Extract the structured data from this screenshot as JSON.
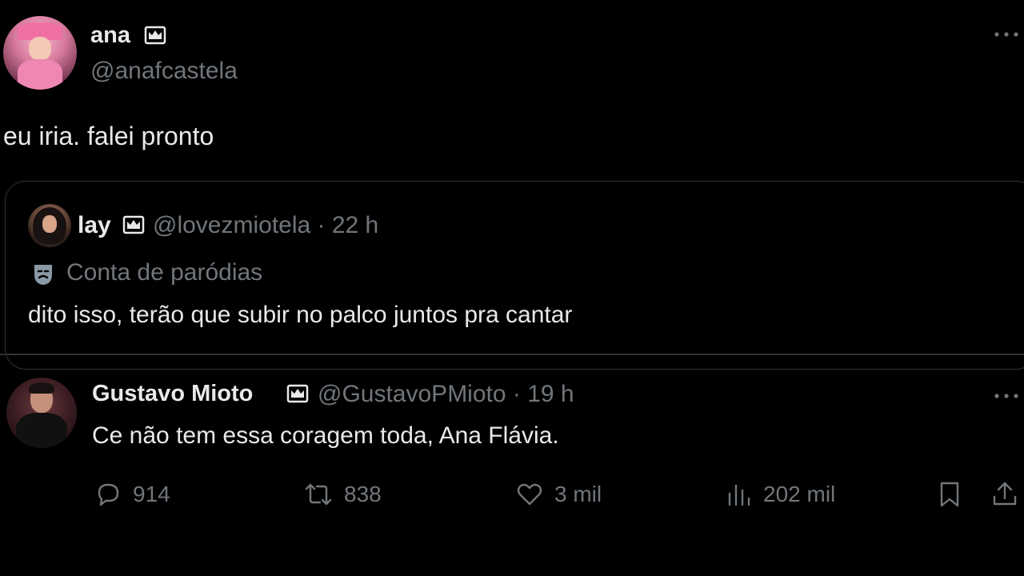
{
  "main_tweet": {
    "name": "ana",
    "handle": "@anafcastela",
    "text": "eu iria. falei pronto",
    "quoted": {
      "name": "lay",
      "handle_time": "@lovezmiotela · 22 h",
      "parody_label": "Conta de paródias",
      "text": "dito isso, terão que subir no palco juntos pra cantar"
    }
  },
  "reply_tweet": {
    "name": "Gustavo Mioto",
    "handle_time": "@GustavoPMioto · 19 h",
    "text": "Ce não tem essa coragem toda, Ana Flávia.",
    "actions": {
      "replies": "914",
      "retweets": "838",
      "likes": "3 mil",
      "views": "202 mil"
    }
  },
  "icons": {
    "verified": "crown-badge-icon",
    "more": "more-options-icon",
    "parody": "theater-mask-icon",
    "reply": "reply-bubble-icon",
    "retweet": "retweet-icon",
    "like": "heart-icon",
    "views": "views-bars-icon",
    "bookmark": "bookmark-icon",
    "share": "share-icon"
  },
  "colors": {
    "background": "#000000",
    "text_primary": "#e7e9ea",
    "text_secondary": "#71767b",
    "border": "#2f3336"
  }
}
